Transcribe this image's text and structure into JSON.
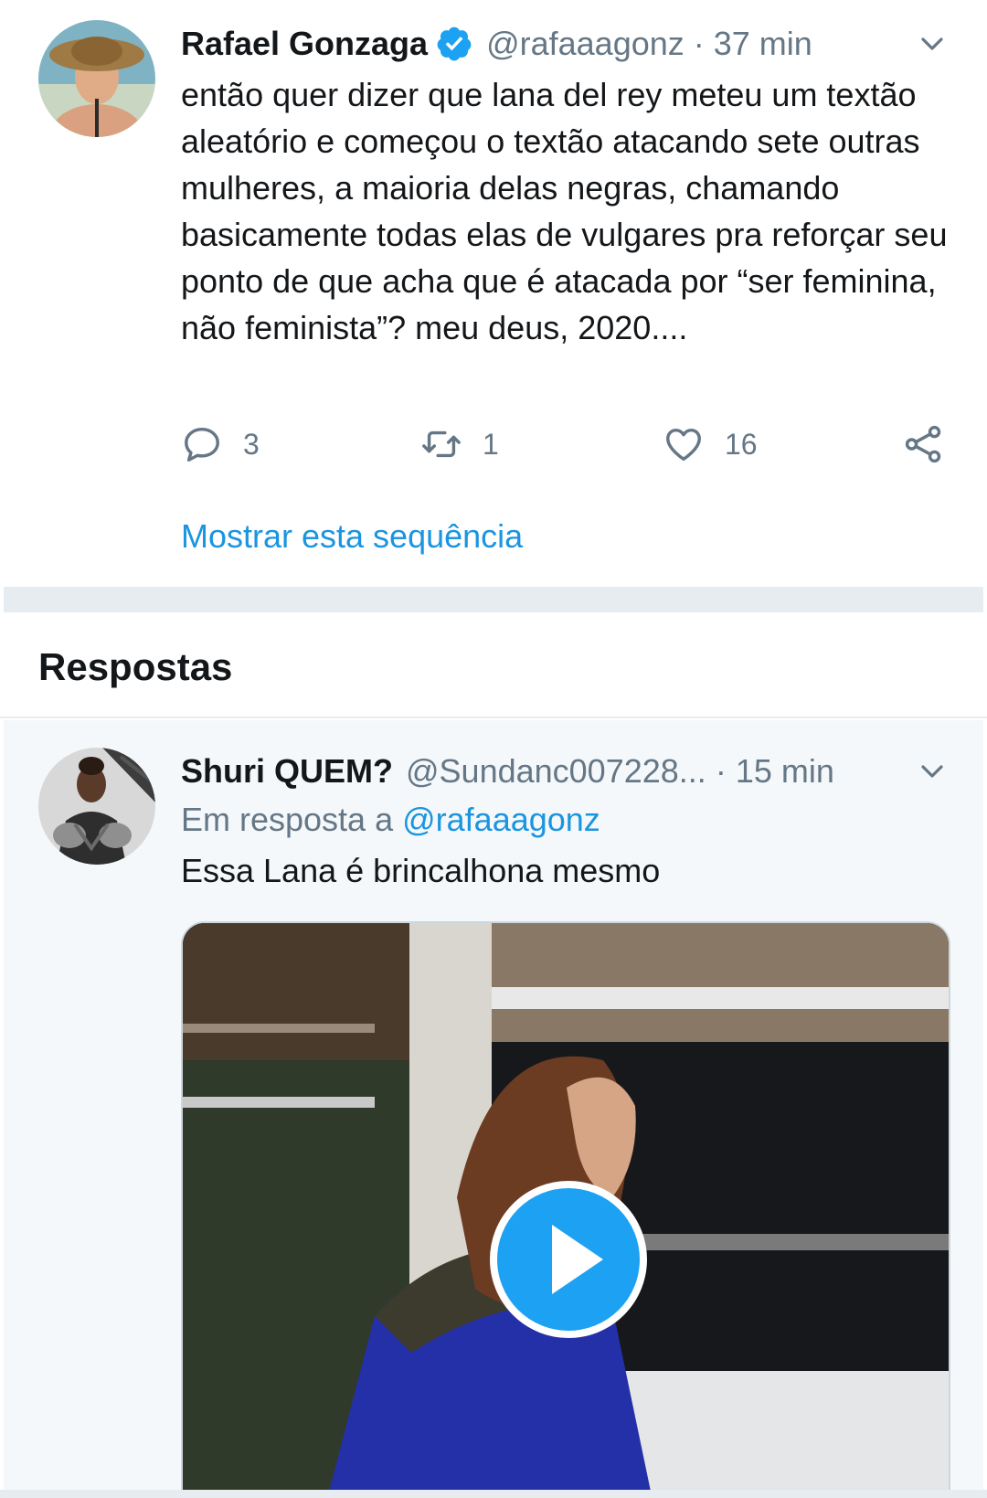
{
  "main_tweet": {
    "display_name": "Rafael Gonzaga",
    "verified_icon": "verified-badge-icon",
    "handle": "@rafaaagonz",
    "separator": "·",
    "time": "37 min",
    "text": "então quer dizer que lana del rey meteu um textão aleatório e começou o textão atacando sete outras mulheres, a maioria delas negras, chamando basicamente todas elas de vulgares pra reforçar seu ponto de que acha que é atacada por “ser feminina, não feminista”? meu deus, 2020....",
    "actions": {
      "reply_count": "3",
      "retweet_count": "1",
      "like_count": "16"
    },
    "show_thread": "Mostrar esta sequência"
  },
  "replies": {
    "title": "Respostas"
  },
  "reply_tweet": {
    "display_name": "Shuri QUEM?",
    "handle": "@Sundanc007228...",
    "separator": "·",
    "time": "15 min",
    "in_reply_prefix": "Em resposta a",
    "in_reply_mention": "@rafaaagonz",
    "text": "Essa Lana é brincalhona mesmo",
    "media_type": "video",
    "play_icon": "play-icon"
  },
  "colors": {
    "accent": "#1da1f2",
    "link": "#1b95e0",
    "muted": "#657786",
    "text": "#14171a",
    "divider": "#e6ecf0",
    "reply_bg": "#f5f8fa"
  }
}
